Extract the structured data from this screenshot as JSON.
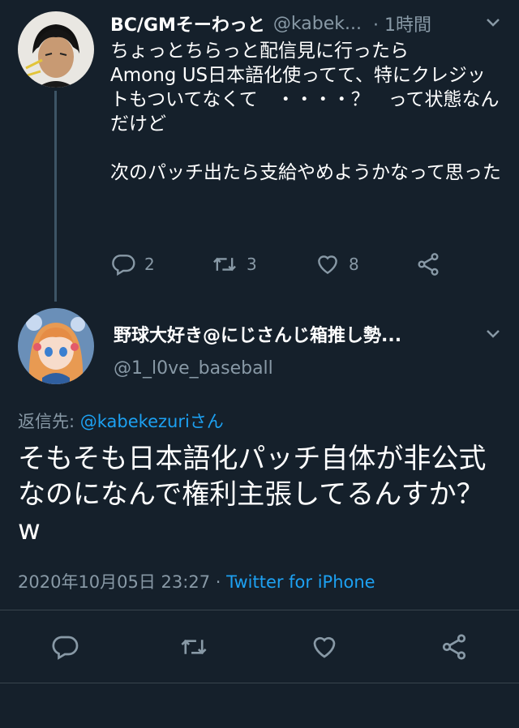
{
  "parent_tweet": {
    "display_name": "BC/GMそーわっと",
    "handle": "@kabek...",
    "time": "· 1時間",
    "text": "ちょっとちらっと配信見に行ったら\nAmong US日本語化使ってて、特にクレジットもついてなくて　・・・・？　って状態なんだけど\n\n次のパッチ出たら支給やめようかなって思った",
    "reply_count": "2",
    "retweet_count": "3",
    "like_count": "8"
  },
  "main_tweet": {
    "display_name": "野球大好き@にじさんじ箱推し勢...",
    "handle": "@1_l0ve_baseball",
    "reply_prefix": "返信先: ",
    "reply_to": "@kabekezuriさん",
    "text": "そもそも日本語化パッチ自体が非公式なのになんで権利主張してるんすか？w",
    "timestamp": "2020年10月05日 23:27 · ",
    "source": "Twitter for iPhone"
  },
  "colors": {
    "background": "#15202b",
    "text": "#ffffff",
    "muted": "#8899a6",
    "accent": "#1da1f2"
  }
}
